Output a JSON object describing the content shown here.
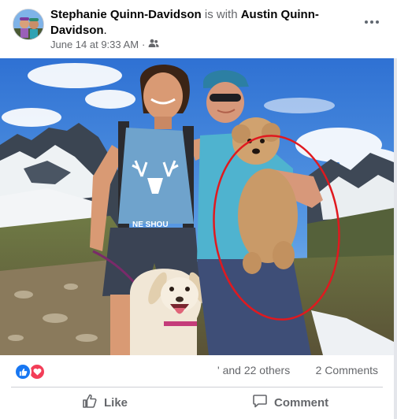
{
  "post": {
    "author": "Stephanie Quinn-Davidson",
    "with_text": "is with",
    "tagged": "Austin Quinn-Davidson",
    "tagged_suffix": ".",
    "date": "June 14 at 9:33 AM",
    "separator": "·",
    "audience_icon": "friends-icon"
  },
  "photo": {
    "shirt_text": "NE SHOU",
    "annotation_color": "#e0191f"
  },
  "reactions": {
    "icons": [
      "like-icon",
      "love-icon"
    ],
    "others_text": "and 22 others",
    "others_prefix": "'",
    "comments_text": "2 Comments"
  },
  "actions": {
    "like_label": "Like",
    "comment_label": "Comment"
  },
  "colors": {
    "like_blue": "#1877f2",
    "love_red": "#f33e58",
    "secondary_text": "#65676b"
  }
}
